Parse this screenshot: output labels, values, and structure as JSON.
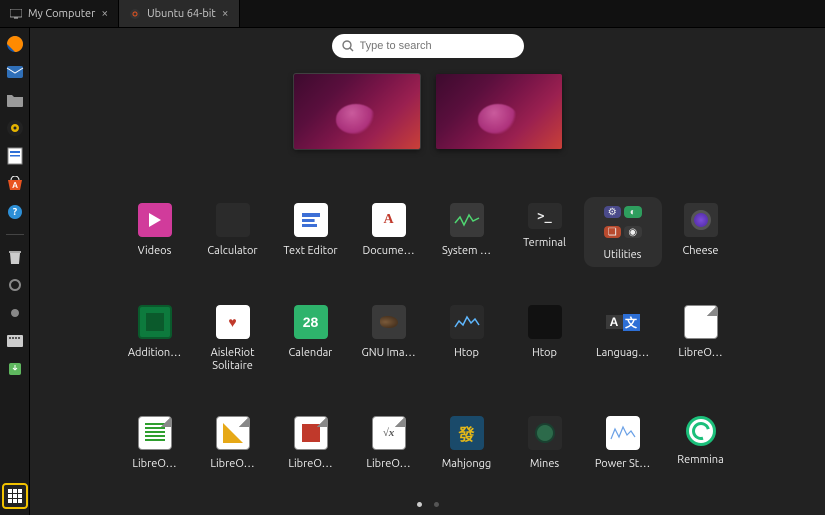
{
  "tabs": [
    {
      "label": "My Computer",
      "active": false
    },
    {
      "label": "Ubuntu 64-bit",
      "active": true
    }
  ],
  "search": {
    "placeholder": "Type to search"
  },
  "workspaces": {
    "count": 2,
    "active_index": 0
  },
  "dock": [
    {
      "name": "firefox-icon",
      "color": "#e66000"
    },
    {
      "name": "thunderbird-icon",
      "color": "#2f6fb8"
    },
    {
      "name": "files-icon",
      "color": "#8a8a8a"
    },
    {
      "name": "rhythmbox-icon",
      "color": "#e6b400"
    },
    {
      "name": "libreoffice-writer-icon",
      "color": "#2d6fd6"
    },
    {
      "name": "software-icon",
      "color": "#d35400"
    },
    {
      "name": "help-icon",
      "color": "#2d8fd6"
    }
  ],
  "dock_bottom": [
    {
      "name": "trash-icon",
      "color": "#cccccc"
    },
    {
      "name": "indicator-icon",
      "color": "#888"
    },
    {
      "name": "indicator-icon-2",
      "color": "#888"
    },
    {
      "name": "keyboard-icon",
      "color": "#cccccc"
    },
    {
      "name": "update-icon",
      "color": "#5fb85f"
    }
  ],
  "apps": [
    {
      "label": "Videos",
      "icon": "videos"
    },
    {
      "label": "Calculator",
      "icon": "calc"
    },
    {
      "label": "Text Editor",
      "icon": "text"
    },
    {
      "label": "Docume…",
      "icon": "doc"
    },
    {
      "label": "System …",
      "icon": "sys"
    },
    {
      "label": "Terminal",
      "icon": "term"
    },
    {
      "label": "Utilities",
      "icon": "util",
      "highlight": true
    },
    {
      "label": "Cheese",
      "icon": "cheese"
    },
    {
      "label": "Addition…",
      "icon": "chip"
    },
    {
      "label": "AisleRiot Solitaire",
      "icon": "sol",
      "two": true
    },
    {
      "label": "Calendar",
      "icon": "cal",
      "cal_text": "28"
    },
    {
      "label": "GNU Ima…",
      "icon": "gimp"
    },
    {
      "label": "Htop",
      "icon": "htop"
    },
    {
      "label": "Htop",
      "icon": "htop2"
    },
    {
      "label": "Languag…",
      "icon": "lang",
      "lang_a": "A",
      "lang_b": "文"
    },
    {
      "label": "LibreO…",
      "icon": "lo"
    },
    {
      "label": "LibreO…",
      "icon": "lo-calc"
    },
    {
      "label": "LibreO…",
      "icon": "lo-draw"
    },
    {
      "label": "LibreO…",
      "icon": "lo-impress"
    },
    {
      "label": "LibreO…",
      "icon": "lo-math"
    },
    {
      "label": "Mahjongg",
      "icon": "mahj",
      "mahj_text": "發"
    },
    {
      "label": "Mines",
      "icon": "mines"
    },
    {
      "label": "Power St…",
      "icon": "power"
    },
    {
      "label": "Remmina",
      "icon": "rem"
    }
  ],
  "pager": {
    "pages": 2,
    "active": 0
  }
}
